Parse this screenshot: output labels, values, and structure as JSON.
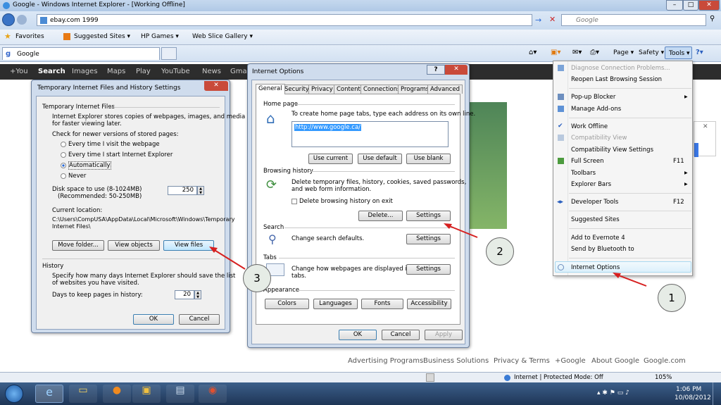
{
  "browser": {
    "title": "Google - Windows Internet Explorer - [Working Offline]",
    "address": "ebay.com 1999",
    "search_placeholder": "Google",
    "tab_label": "Google",
    "favorites": {
      "label": "Favorites",
      "items": [
        "Suggested Sites ▾",
        "HP Games ▾",
        "Web Slice Gallery ▾"
      ]
    },
    "cmd": {
      "page": "Page ▾",
      "safety": "Safety ▾",
      "tools": "Tools ▾",
      "help": "?▾"
    }
  },
  "google_bar": [
    "+You",
    "Search",
    "Images",
    "Maps",
    "Play",
    "YouTube",
    "News",
    "Gma"
  ],
  "tools_menu": {
    "items": [
      {
        "label": "Diagnose Connection Problems...",
        "disabled": true
      },
      {
        "label": "Reopen Last Browsing Session"
      },
      {
        "label": "Pop-up Blocker",
        "arrow": "▶"
      },
      {
        "label": "Manage Add-ons"
      },
      {
        "label": "Work Offline",
        "check": "✔"
      },
      {
        "label": "Compatibility View",
        "disabled": true
      },
      {
        "label": "Compatibility View Settings"
      },
      {
        "label": "Full Screen",
        "key": "F11"
      },
      {
        "label": "Toolbars",
        "arrow": "▶"
      },
      {
        "label": "Explorer Bars",
        "arrow": "▶"
      },
      {
        "label": "Developer Tools",
        "key": "F12"
      },
      {
        "label": "Suggested Sites"
      },
      {
        "label": "Add to Evernote 4"
      },
      {
        "label": "Send by Bluetooth to"
      },
      {
        "label": "Internet Options"
      }
    ]
  },
  "temp_dialog": {
    "title": "Temporary Internet Files and History Settings",
    "group1": "Temporary Internet Files",
    "desc1": "Internet Explorer stores copies of webpages, images, and media",
    "desc2": "for faster viewing later.",
    "check_label": "Check for newer versions of stored pages:",
    "radios": [
      "Every time I visit the webpage",
      "Every time I start Internet Explorer",
      "Automatically",
      "Never"
    ],
    "disk1": "Disk space to use (8-1024MB)",
    "disk2": "(Recommended: 50-250MB)",
    "disk_value": "250",
    "loc_label": "Current location:",
    "loc1": "C:\\Users\\CompUSA\\AppData\\Local\\Microsoft\\Windows\\Temporary",
    "loc2": "Internet Files\\",
    "btn_move": "Move folder...",
    "btn_objects": "View objects",
    "btn_files": "View files",
    "group2": "History",
    "hist1": "Specify how many days Internet Explorer should save the list",
    "hist2": "of websites you have visited.",
    "days_label": "Days to keep pages in history:",
    "days_value": "20",
    "ok": "OK",
    "cancel": "Cancel"
  },
  "io_dialog": {
    "title": "Internet Options",
    "tabs": [
      "General",
      "Security",
      "Privacy",
      "Content",
      "Connections",
      "Programs",
      "Advanced"
    ],
    "home_label": "Home page",
    "home_desc": "To create home page tabs, type each address on its own line.",
    "home_url": "http://www.google.ca/",
    "btn_current": "Use current",
    "btn_default": "Use default",
    "btn_blank": "Use blank",
    "bh_label": "Browsing history",
    "bh1": "Delete temporary files, history, cookies, saved passwords,",
    "bh2": "and web form information.",
    "bh_check": "Delete browsing history on exit",
    "btn_delete": "Delete...",
    "btn_settings": "Settings",
    "search_label": "Search",
    "search_desc": "Change search defaults.",
    "tabs_label": "Tabs",
    "tabs_desc1": "Change how webpages are displayed in",
    "tabs_desc2": "tabs.",
    "app_label": "Appearance",
    "btn_colors": "Colors",
    "btn_languages": "Languages",
    "btn_fonts": "Fonts",
    "btn_access": "Accessibility",
    "ok": "OK",
    "cancel": "Cancel",
    "apply": "Apply"
  },
  "callouts": [
    "1",
    "2",
    "3"
  ],
  "footer": [
    "Advertising Programs",
    "Business Solutions",
    "Privacy & Terms",
    "+Google",
    "About Google",
    "Google.com"
  ],
  "status": {
    "zone": "Internet | Protected Mode: Off",
    "zoom": "105%"
  },
  "clock": {
    "time": "1:06 PM",
    "date": "10/08/2012"
  }
}
